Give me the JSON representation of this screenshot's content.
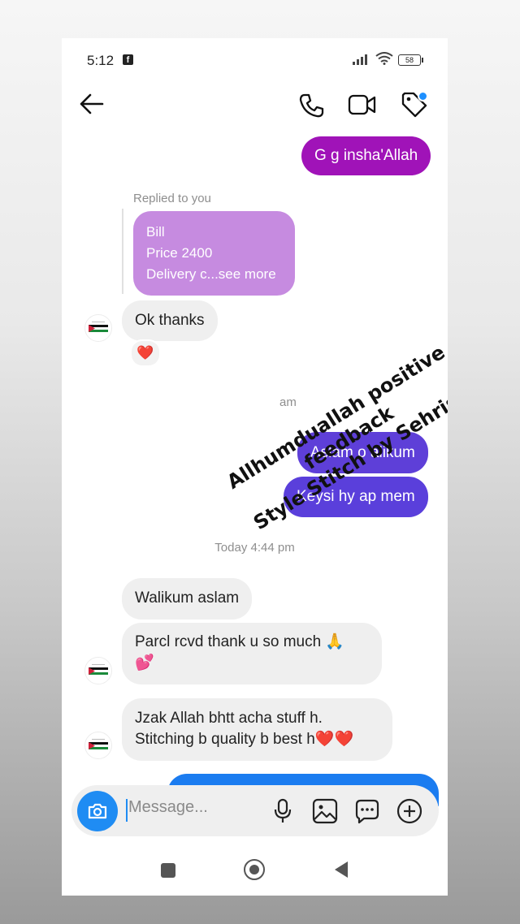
{
  "status_bar": {
    "time": "5:12",
    "battery": "58",
    "fb_icon": "facebook-icon"
  },
  "header": {
    "icons": [
      "back-arrow-icon",
      "phone-icon",
      "video-camera-icon",
      "tag-icon"
    ],
    "tag_dot_color": "#1e90ff"
  },
  "messages": {
    "outgoing_1": "G g insha'Allah",
    "replied_label": "Replied to you",
    "reply_preview": [
      "Bill",
      "Price 2400",
      "Delivery c...see more"
    ],
    "incoming_ok": "Ok thanks",
    "reaction": "❤️",
    "partial_timestamp": "am",
    "outgoing_2": "Aslam o alikum",
    "outgoing_3": "Keysi hy ap mem",
    "today_timestamp": "Today 4:44 pm",
    "incoming_1": "Walikum aslam",
    "incoming_2_line1": "Parcl rcvd thank u so much 🙏",
    "incoming_2_line2": "💕",
    "incoming_3_line1": "Jzak Allah bhtt acha stuff h.",
    "incoming_3_line2": "Stitching b quality b best h❤️❤️"
  },
  "overlay_text": {
    "line1": "Allhumduallah positive",
    "line2": "feedback",
    "line3": "Style Stitch by Sehrish"
  },
  "composer": {
    "placeholder": "Message...",
    "icons": [
      "camera-icon",
      "microphone-icon",
      "gallery-icon",
      "sticker-icon",
      "plus-icon"
    ]
  },
  "nav": {
    "icons": [
      "recents-icon",
      "home-icon",
      "back-icon"
    ]
  },
  "colors": {
    "outgoing_purple": "#a013b8",
    "reply_lilac": "#c68be0",
    "outgoing_indigo": "#5e3fd8",
    "incoming_gray": "#efefef",
    "accent_blue": "#1f8cf3"
  }
}
